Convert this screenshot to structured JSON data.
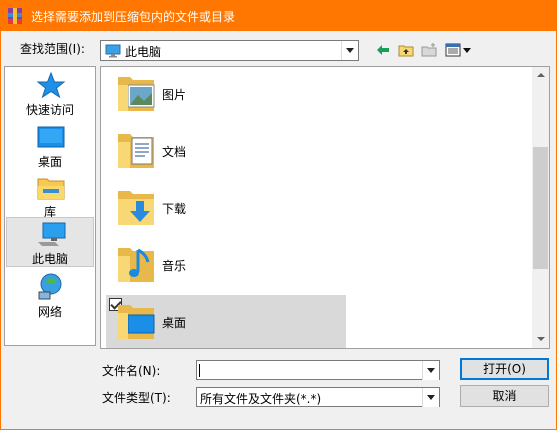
{
  "window": {
    "title": "选择需要添加到压缩包内的文件或目录"
  },
  "toolbar": {
    "look_in_label": "查找范围(I):",
    "look_in_value": "此电脑",
    "buttons": [
      "back-arrow-icon",
      "up-folder-icon",
      "new-folder-icon",
      "view-menu-icon"
    ]
  },
  "places": [
    {
      "label": "快速访问",
      "icon": "star-icon"
    },
    {
      "label": "桌面",
      "icon": "desktop-icon"
    },
    {
      "label": "库",
      "icon": "library-icon"
    },
    {
      "label": "此电脑",
      "icon": "computer-icon",
      "selected": true
    },
    {
      "label": "网络",
      "icon": "network-icon"
    }
  ],
  "files": [
    {
      "label": "图片",
      "icon": "pictures-folder-icon"
    },
    {
      "label": "文档",
      "icon": "documents-folder-icon"
    },
    {
      "label": "下载",
      "icon": "downloads-folder-icon"
    },
    {
      "label": "音乐",
      "icon": "music-folder-icon"
    },
    {
      "label": "桌面",
      "icon": "desktop-folder-icon",
      "checked": true,
      "hovered": true
    }
  ],
  "filename": {
    "label": "文件名(N):",
    "value": ""
  },
  "filetype": {
    "label": "文件类型(T):",
    "value": "所有文件及文件夹(*.*)"
  },
  "buttons": {
    "open": "打开(O)",
    "cancel": "取消"
  },
  "colors": {
    "titlebar": "#ff7700",
    "accent": "#0078d7",
    "folder": "#f8d775"
  }
}
